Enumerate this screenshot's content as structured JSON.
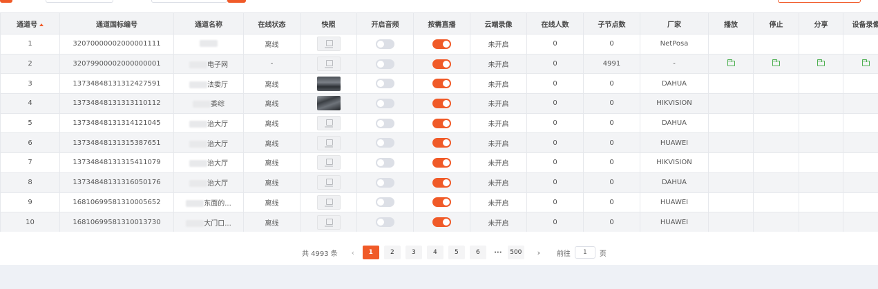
{
  "colors": {
    "accent": "#f05a28",
    "folder": "#4caf50"
  },
  "table": {
    "headers": [
      "通道号",
      "通道国标编号",
      "通道名称",
      "在线状态",
      "快照",
      "开启音频",
      "按需直播",
      "云端录像",
      "在线人数",
      "子节点数",
      "厂家",
      "播放",
      "停止",
      "分享",
      "设备录像"
    ],
    "rows": [
      {
        "no": "1",
        "code": "32070000002000001111",
        "name": "",
        "status": "离线",
        "snap": "placeholder",
        "audio": false,
        "live": true,
        "cloud": "未开启",
        "online": "0",
        "children": "0",
        "vendor": "NetPosa",
        "actions": false
      },
      {
        "no": "2",
        "code": "32079900002000000001",
        "name": "电子网",
        "status": "-",
        "snap": "placeholder",
        "audio": false,
        "live": true,
        "cloud": "未开启",
        "online": "0",
        "children": "4991",
        "vendor": "-",
        "actions": true
      },
      {
        "no": "3",
        "code": "13734848131312427591",
        "name": "法委厅",
        "status": "离线",
        "snap": "photo1",
        "audio": false,
        "live": true,
        "cloud": "未开启",
        "online": "0",
        "children": "0",
        "vendor": "DAHUA",
        "actions": false
      },
      {
        "no": "4",
        "code": "13734848131313110112",
        "name": "委综",
        "status": "离线",
        "snap": "photo2",
        "audio": false,
        "live": true,
        "cloud": "未开启",
        "online": "0",
        "children": "0",
        "vendor": "HIKVISION",
        "actions": false
      },
      {
        "no": "5",
        "code": "13734848131314121045",
        "name": "治大厅",
        "status": "离线",
        "snap": "placeholder",
        "audio": false,
        "live": true,
        "cloud": "未开启",
        "online": "0",
        "children": "0",
        "vendor": "DAHUA",
        "actions": false
      },
      {
        "no": "6",
        "code": "13734848131315387651",
        "name": "治大厅",
        "status": "离线",
        "snap": "placeholder",
        "audio": false,
        "live": true,
        "cloud": "未开启",
        "online": "0",
        "children": "0",
        "vendor": "HUAWEI",
        "actions": false
      },
      {
        "no": "7",
        "code": "13734848131315411079",
        "name": "治大厅",
        "status": "离线",
        "snap": "placeholder",
        "audio": false,
        "live": true,
        "cloud": "未开启",
        "online": "0",
        "children": "0",
        "vendor": "HIKVISION",
        "actions": false
      },
      {
        "no": "8",
        "code": "13734848131316050176",
        "name": "治大厅",
        "status": "离线",
        "snap": "placeholder",
        "audio": false,
        "live": true,
        "cloud": "未开启",
        "online": "0",
        "children": "0",
        "vendor": "DAHUA",
        "actions": false
      },
      {
        "no": "9",
        "code": "16810699581310005652",
        "name": "东面的...",
        "status": "离线",
        "snap": "placeholder",
        "audio": false,
        "live": true,
        "cloud": "未开启",
        "online": "0",
        "children": "0",
        "vendor": "HUAWEI",
        "actions": false
      },
      {
        "no": "10",
        "code": "16810699581310013730",
        "name": "大门口...",
        "status": "离线",
        "snap": "placeholder",
        "audio": false,
        "live": true,
        "cloud": "未开启",
        "online": "0",
        "children": "0",
        "vendor": "HUAWEI",
        "actions": false
      }
    ]
  },
  "pagination": {
    "total": "共 4993 条",
    "prev": "‹",
    "pages": [
      "1",
      "2",
      "3",
      "4",
      "5",
      "6"
    ],
    "more": "···",
    "last": "500",
    "next": "›",
    "goto_label": "前往",
    "goto_value": "1",
    "goto_suffix": "页"
  }
}
